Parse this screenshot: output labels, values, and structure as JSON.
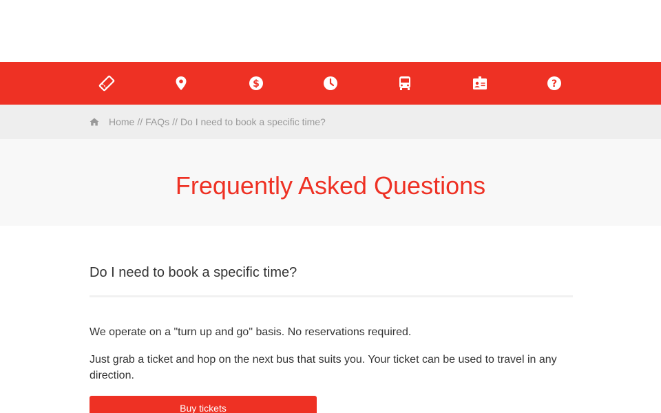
{
  "colors": {
    "brand_red": "#ee3124",
    "breadcrumb_bg": "#eeeeee",
    "hero_bg": "#f8f8f8"
  },
  "nav": {
    "items": [
      {
        "icon": "ticket-icon"
      },
      {
        "icon": "map-pin-icon"
      },
      {
        "icon": "dollar-icon"
      },
      {
        "icon": "clock-icon"
      },
      {
        "icon": "bus-icon"
      },
      {
        "icon": "id-card-icon"
      },
      {
        "icon": "question-icon"
      }
    ]
  },
  "breadcrumb": {
    "home": "Home",
    "faqs": "FAQs",
    "current": "Do I need to book a specific time?",
    "separator": "//"
  },
  "hero": {
    "title": "Frequently Asked Questions"
  },
  "faq": {
    "question": "Do I need to book a specific time?",
    "answer_1": "We operate on a \"turn up and go\" basis. No reservations required.",
    "answer_2": "Just grab a ticket and hop on the next bus that suits you. Your ticket can be used to travel in any direction.",
    "button_label": "Buy tickets"
  }
}
